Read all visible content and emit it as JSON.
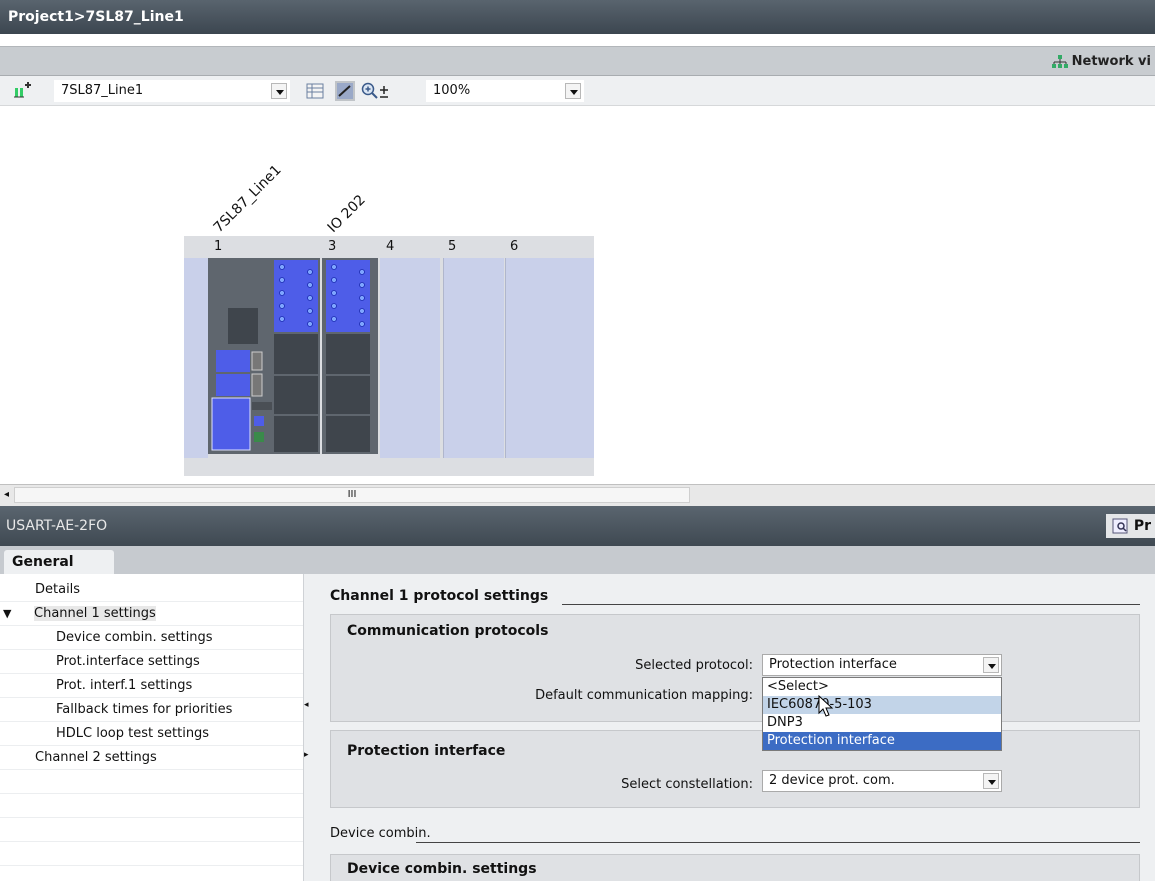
{
  "window": {
    "breadcrumb": "Project1>7SL87_Line1"
  },
  "viewbar": {
    "network_view_label": "Network vi"
  },
  "toolbar": {
    "device_select": "7SL87_Line1",
    "zoom_value": "100%"
  },
  "canvas": {
    "device_label": "7SL87_Line1",
    "module_label": "IO 202",
    "slot_numbers": [
      "1",
      "3",
      "4",
      "5",
      "6"
    ]
  },
  "scrollbar": {
    "thumb_grip": "III"
  },
  "properties": {
    "module_name": "USART-AE-2FO",
    "properties_button": "Pr",
    "tab_general": "General"
  },
  "tree": {
    "items": [
      {
        "label": "Details"
      },
      {
        "label": "Channel 1 settings"
      },
      {
        "label": "Device combin. settings"
      },
      {
        "label": "Prot.interface settings"
      },
      {
        "label": "Prot. interf.1 settings"
      },
      {
        "label": "Fallback times for priorities"
      },
      {
        "label": "HDLC loop test settings"
      },
      {
        "label": "Channel 2 settings"
      }
    ]
  },
  "details": {
    "section_title": "Channel 1 protocol settings",
    "comm_group_title": "Communication protocols",
    "selected_protocol_label": "Selected protocol:",
    "selected_protocol_value": "Protection interface",
    "default_mapping_label": "Default communication mapping:",
    "dropdown_options": [
      "<Select>",
      "IEC60870-5-103",
      "DNP3",
      "Protection interface"
    ],
    "prot_group_title": "Protection interface",
    "constellation_label": "Select constellation:",
    "constellation_value": "2 device prot. com.",
    "device_combin_section": "Device combin.",
    "device_combin_group_title": "Device combin. settings"
  },
  "colors": {
    "title_bar": "#3c4650",
    "selection_blue": "#3c6cc4",
    "hover_blue": "#c2d4e8",
    "slot_fill": "#c9d0ea",
    "module_blue": "#4e5de8"
  }
}
